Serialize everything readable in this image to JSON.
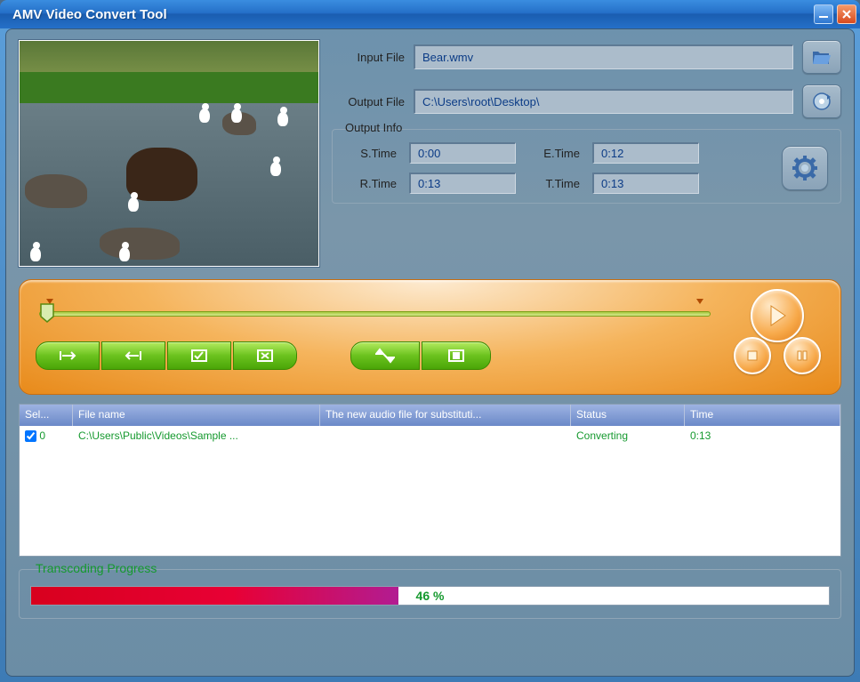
{
  "window": {
    "title": "AMV Video Convert Tool"
  },
  "files": {
    "input_label": "Input File",
    "input_value": "Bear.wmv",
    "output_label": "Output File",
    "output_value": "C:\\Users\\root\\Desktop\\"
  },
  "output_info": {
    "legend": "Output Info",
    "stime_label": "S.Time",
    "stime": "0:00",
    "etime_label": "E.Time",
    "etime": "0:12",
    "rtime_label": "R.Time",
    "rtime": "0:13",
    "ttime_label": "T.Time",
    "ttime": "0:13"
  },
  "columns": {
    "sel": "Sel...",
    "filename": "File name",
    "audio": "The new audio file for substituti...",
    "status": "Status",
    "time": "Time"
  },
  "rows": [
    {
      "checked": true,
      "idx": "0",
      "filename": "C:\\Users\\Public\\Videos\\Sample ...",
      "audio": "",
      "status": "Converting",
      "time": "0:13"
    }
  ],
  "progress": {
    "legend": "Transcoding Progress",
    "percent": 46,
    "text": "46 %"
  }
}
